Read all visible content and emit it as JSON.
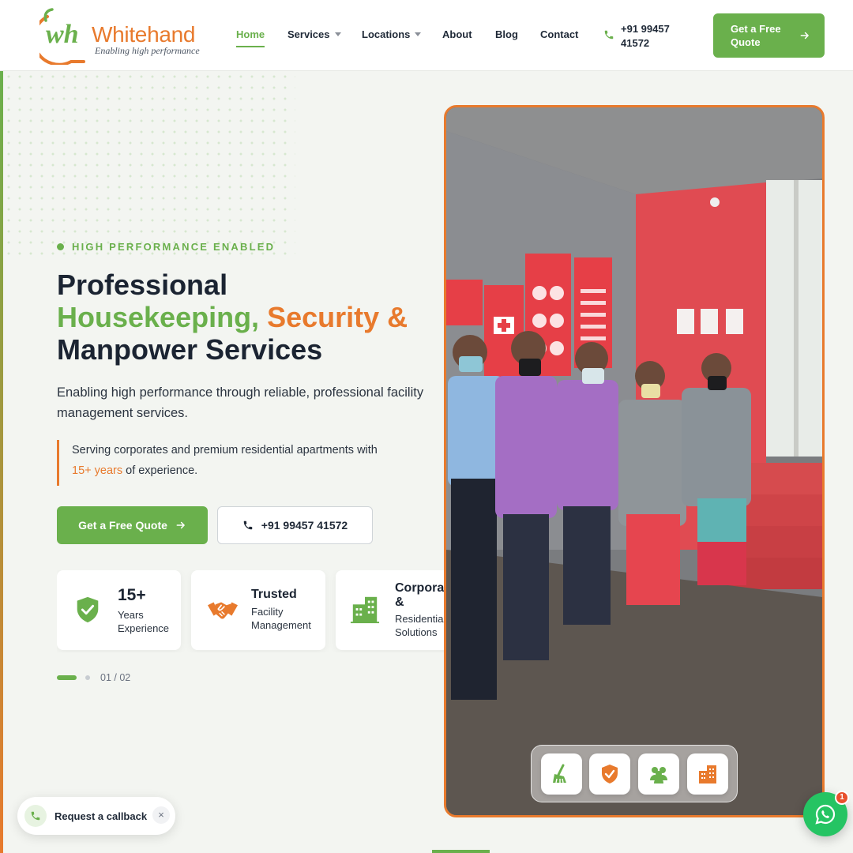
{
  "brand": {
    "name": "Whitehand",
    "mark": "wh",
    "tagline": "Enabling high performance",
    "colors": {
      "green": "#6ab04c",
      "orange": "#e87a2d",
      "dark": "#1b2432"
    }
  },
  "nav": {
    "items": [
      {
        "label": "Home",
        "active": true
      },
      {
        "label": "Services",
        "dropdown": true
      },
      {
        "label": "Locations",
        "dropdown": true
      },
      {
        "label": "About"
      },
      {
        "label": "Blog"
      },
      {
        "label": "Contact"
      }
    ],
    "phone": "+91 99457 41572",
    "phone_icon": "phone-icon",
    "cta_label": "Get a Free Quote",
    "cta_icon": "arrow-right-icon"
  },
  "hero": {
    "eyebrow": "HIGH PERFORMANCE ENABLED",
    "headline": {
      "line1": "Professional",
      "green": "Housekeeping,",
      "orange": "Security &",
      "line3": "Manpower Services"
    },
    "subtext": "Enabling high performance through reliable, professional facility management services.",
    "quote": {
      "before": "Serving corporates and premium residential apartments with",
      "highlight": "15+ years",
      "after": "of experience."
    },
    "primary_button": "Get a Free Quote",
    "secondary_button": "+91 99457 41572",
    "features": [
      {
        "icon": "shield-check-icon",
        "title": "15+",
        "subtitle_line1": "Years",
        "subtitle_line2": "Experience"
      },
      {
        "icon": "handshake-icon",
        "title": "Trusted",
        "subtitle_line1": "Facility",
        "subtitle_line2": "Management"
      },
      {
        "icon": "building-icon",
        "title": "Corporate &",
        "subtitle_line1": "Residential",
        "subtitle_line2": "Solutions"
      }
    ],
    "pager": "01 / 02",
    "photo_service_icons": [
      "cleaning-icon",
      "security-shield-icon",
      "team-icon",
      "building-icon"
    ]
  },
  "callback": {
    "label": "Request a callback",
    "close": "×",
    "icon": "phone-call-icon"
  },
  "whatsapp": {
    "icon": "whatsapp-icon",
    "badge": "1"
  }
}
